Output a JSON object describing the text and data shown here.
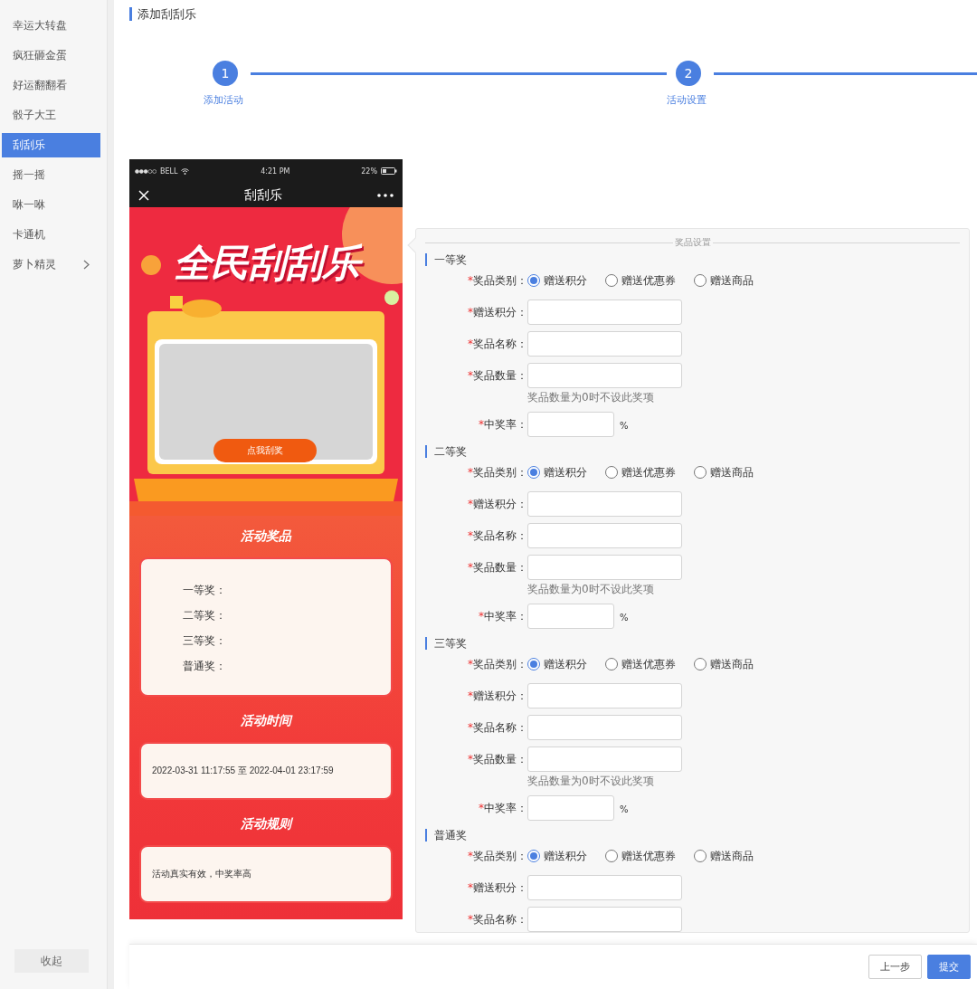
{
  "sidebar": {
    "items": [
      {
        "label": "幸运大转盘",
        "selected": false,
        "expandable": false
      },
      {
        "label": "疯狂砸金蛋",
        "selected": false,
        "expandable": false
      },
      {
        "label": "好运翻翻看",
        "selected": false,
        "expandable": false
      },
      {
        "label": "骰子大王",
        "selected": false,
        "expandable": false
      },
      {
        "label": "刮刮乐",
        "selected": true,
        "expandable": false
      },
      {
        "label": "摇一摇",
        "selected": false,
        "expandable": false
      },
      {
        "label": "咻一咻",
        "selected": false,
        "expandable": false
      },
      {
        "label": "卡通机",
        "selected": false,
        "expandable": false
      },
      {
        "label": "萝卜精灵",
        "selected": false,
        "expandable": true
      }
    ],
    "collapse_label": "收起"
  },
  "page_title": "添加刮刮乐",
  "steps": [
    {
      "number": "1",
      "label": "添加活动"
    },
    {
      "number": "2",
      "label": "活动设置"
    }
  ],
  "phone": {
    "carrier": "BELL",
    "time": "4:21 PM",
    "battery": "22%",
    "title": "刮刮乐",
    "banner_title": "全民刮刮乐",
    "scratch_button": "点我刮奖",
    "sections": [
      {
        "kind": "list",
        "title": "活动奖品",
        "lines": [
          "一等奖：",
          "二等奖：",
          "三等奖：",
          "普通奖："
        ]
      },
      {
        "kind": "text",
        "title": "活动时间",
        "text": "2022-03-31 11:17:55 至 2022-04-01 23:17:59"
      },
      {
        "kind": "text",
        "title": "活动规则",
        "text": "活动真实有效，中奖率高"
      }
    ]
  },
  "form": {
    "legend": "奖品设置",
    "prizes": [
      {
        "title": "一等奖",
        "rows": [
          {
            "kind": "radio",
            "required_mark": "*",
            "label": "奖品类别：",
            "options": [
              {
                "label": "赠送积分",
                "selected": true
              },
              {
                "label": "赠送优惠券",
                "selected": false
              },
              {
                "label": "赠送商品",
                "selected": false
              }
            ]
          },
          {
            "kind": "input",
            "required_mark": "*",
            "label": "赠送积分："
          },
          {
            "kind": "input",
            "required_mark": "*",
            "label": "奖品名称："
          },
          {
            "kind": "input",
            "required_mark": "*",
            "label": "奖品数量：",
            "hint": "奖品数量为0时不设此奖项"
          },
          {
            "kind": "percent",
            "required_mark": "*",
            "label": "中奖率：",
            "suffix": "%"
          }
        ]
      },
      {
        "title": "二等奖",
        "rows": [
          {
            "kind": "radio",
            "required_mark": "*",
            "label": "奖品类别：",
            "options": [
              {
                "label": "赠送积分",
                "selected": true
              },
              {
                "label": "赠送优惠券",
                "selected": false
              },
              {
                "label": "赠送商品",
                "selected": false
              }
            ]
          },
          {
            "kind": "input",
            "required_mark": "*",
            "label": "赠送积分："
          },
          {
            "kind": "input",
            "required_mark": "*",
            "label": "奖品名称："
          },
          {
            "kind": "input",
            "required_mark": "*",
            "label": "奖品数量：",
            "hint": "奖品数量为0时不设此奖项"
          },
          {
            "kind": "percent",
            "required_mark": "*",
            "label": "中奖率：",
            "suffix": "%"
          }
        ]
      },
      {
        "title": "三等奖",
        "rows": [
          {
            "kind": "radio",
            "required_mark": "*",
            "label": "奖品类别：",
            "options": [
              {
                "label": "赠送积分",
                "selected": true
              },
              {
                "label": "赠送优惠券",
                "selected": false
              },
              {
                "label": "赠送商品",
                "selected": false
              }
            ]
          },
          {
            "kind": "input",
            "required_mark": "*",
            "label": "赠送积分："
          },
          {
            "kind": "input",
            "required_mark": "*",
            "label": "奖品名称："
          },
          {
            "kind": "input",
            "required_mark": "*",
            "label": "奖品数量：",
            "hint": "奖品数量为0时不设此奖项"
          },
          {
            "kind": "percent",
            "required_mark": "*",
            "label": "中奖率：",
            "suffix": "%"
          }
        ]
      },
      {
        "title": "普通奖",
        "rows": [
          {
            "kind": "radio",
            "required_mark": "*",
            "label": "奖品类别：",
            "options": [
              {
                "label": "赠送积分",
                "selected": true
              },
              {
                "label": "赠送优惠券",
                "selected": false
              },
              {
                "label": "赠送商品",
                "selected": false
              }
            ]
          },
          {
            "kind": "input",
            "required_mark": "*",
            "label": "赠送积分："
          },
          {
            "kind": "input",
            "required_mark": "*",
            "label": "奖品名称："
          }
        ]
      }
    ]
  },
  "footer": {
    "buttons": [
      {
        "label": "上一步",
        "kind": "default"
      },
      {
        "label": "提交",
        "kind": "primary"
      }
    ]
  }
}
